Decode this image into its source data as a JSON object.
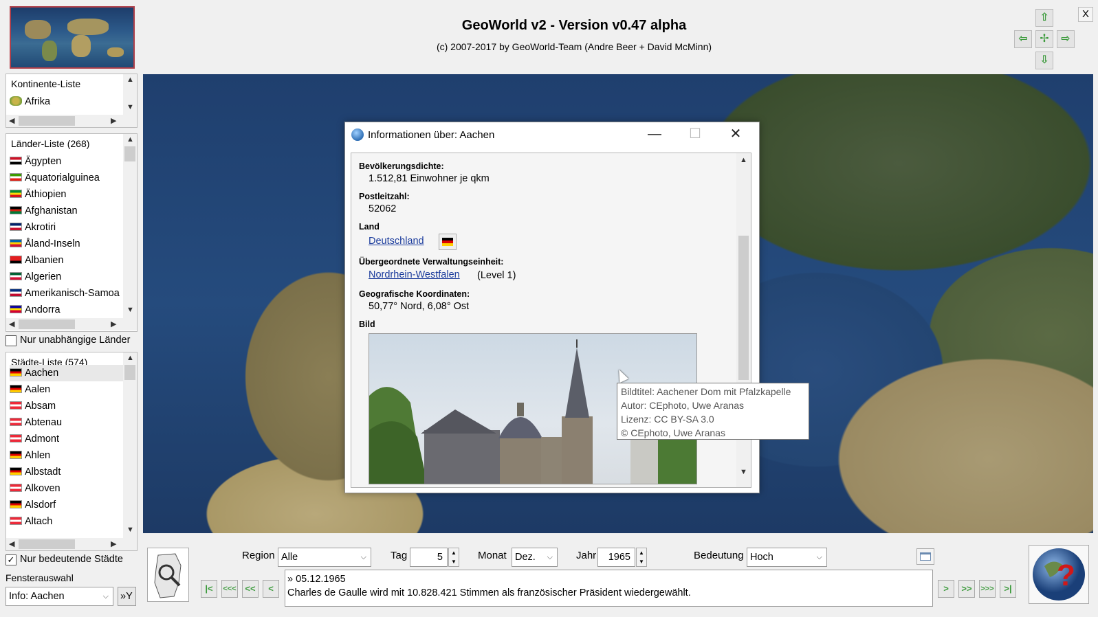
{
  "app": {
    "title": "GeoWorld v2 - Version v0.47 alpha",
    "subtitle": "(c) 2007-2017 by GeoWorld-Team (Andre Beer + David McMinn)",
    "close_label": "X"
  },
  "nav_arrows": {
    "up": "⇧",
    "left": "⇦",
    "center": "✢",
    "right": "⇨",
    "down": "⇩"
  },
  "continents": {
    "header": "Kontinente-Liste",
    "items": [
      {
        "label": "Afrika"
      }
    ]
  },
  "countries": {
    "header": "Länder-Liste  (268)",
    "items": [
      {
        "label": "Ägypten",
        "flag": [
          "#ce1126",
          "#ffffff",
          "#000000"
        ]
      },
      {
        "label": "Äquatorialguinea",
        "flag": [
          "#3e9a00",
          "#ffffff",
          "#e32118"
        ]
      },
      {
        "label": "Äthiopien",
        "flag": [
          "#078930",
          "#fcdd09",
          "#da121a"
        ]
      },
      {
        "label": "Afghanistan",
        "flag": [
          "#000000",
          "#d32011",
          "#007a36"
        ]
      },
      {
        "label": "Akrotiri",
        "flag": [
          "#012169",
          "#ffffff",
          "#c8102e"
        ]
      },
      {
        "label": "Åland-Inseln",
        "flag": [
          "#0064ae",
          "#ffce00",
          "#d21034"
        ]
      },
      {
        "label": "Albanien",
        "flag": [
          "#e41e20",
          "#e41e20",
          "#000000"
        ]
      },
      {
        "label": "Algerien",
        "flag": [
          "#006233",
          "#ffffff",
          "#d21034"
        ]
      },
      {
        "label": "Amerikanisch-Samoa",
        "flag": [
          "#002b7f",
          "#ffffff",
          "#bf0a30"
        ]
      },
      {
        "label": "Andorra",
        "flag": [
          "#10069f",
          "#fedf00",
          "#d50032"
        ]
      }
    ]
  },
  "independent_only": {
    "label": "Nur unabhängige Länder",
    "checked": false
  },
  "cities": {
    "header": "Städte-Liste  (574)",
    "items": [
      {
        "label": "Aachen",
        "flag": [
          "#000000",
          "#dd0000",
          "#ffce00"
        ],
        "selected": true
      },
      {
        "label": "Aalen",
        "flag": [
          "#000000",
          "#dd0000",
          "#ffce00"
        ]
      },
      {
        "label": "Absam",
        "flag": [
          "#ed2939",
          "#ffffff",
          "#ed2939"
        ]
      },
      {
        "label": "Abtenau",
        "flag": [
          "#ed2939",
          "#ffffff",
          "#ed2939"
        ]
      },
      {
        "label": "Admont",
        "flag": [
          "#ed2939",
          "#ffffff",
          "#ed2939"
        ]
      },
      {
        "label": "Ahlen",
        "flag": [
          "#000000",
          "#dd0000",
          "#ffce00"
        ]
      },
      {
        "label": "Albstadt",
        "flag": [
          "#000000",
          "#dd0000",
          "#ffce00"
        ]
      },
      {
        "label": "Alkoven",
        "flag": [
          "#ed2939",
          "#ffffff",
          "#ed2939"
        ]
      },
      {
        "label": "Alsdorf",
        "flag": [
          "#000000",
          "#dd0000",
          "#ffce00"
        ]
      },
      {
        "label": "Altach",
        "flag": [
          "#ed2939",
          "#ffffff",
          "#ed2939"
        ]
      }
    ]
  },
  "important_only": {
    "label": "Nur bedeutende Städte",
    "checked": true
  },
  "window_select": {
    "label": "Fensterauswahl",
    "value": "Info: Aachen",
    "button": "»Y"
  },
  "info_dialog": {
    "title": "Informationen über: Aachen",
    "controls": {
      "minimize": "—",
      "maximize": "☐",
      "close": "✕"
    },
    "density_label": "Bevölkerungsdichte:",
    "density_value": "1.512,81  Einwohner je qkm",
    "postal_label": "Postleitzahl:",
    "postal_value": "52062",
    "country_label": "Land",
    "country_value": "Deutschland",
    "admin_label": "Übergeordnete Verwaltungseinheit:",
    "admin_value": "Nordrhein-Westfalen",
    "admin_level": "(Level 1)",
    "coords_label": "Geografische Koordinaten:",
    "coords_value": "50,77° Nord, 6,08° Ost",
    "image_label": "Bild"
  },
  "tooltip": {
    "line1": "Bildtitel: Aachener Dom mit Pfalzkapelle",
    "line2": "Autor: CEphoto, Uwe Aranas",
    "line3": "Lizenz: CC BY-SA 3.0",
    "line4": "© CEphoto, Uwe Aranas"
  },
  "filters": {
    "region_label": "Region",
    "region_value": "Alle",
    "day_label": "Tag",
    "day_value": "5",
    "month_label": "Monat",
    "month_value": "Dez.",
    "year_label": "Jahr",
    "year_value": "1965",
    "importance_label": "Bedeutung",
    "importance_value": "Hoch"
  },
  "playback": {
    "first": "|<",
    "prev3": "<<<",
    "prev2": "<<",
    "prev1": "<",
    "next1": ">",
    "next2": ">>",
    "next3": ">>>",
    "last": ">|"
  },
  "event": {
    "date": "» 05.12.1965",
    "text": "Charles de Gaulle wird mit 10.828.421 Stimmen als französischer Präsident wiedergewählt."
  }
}
